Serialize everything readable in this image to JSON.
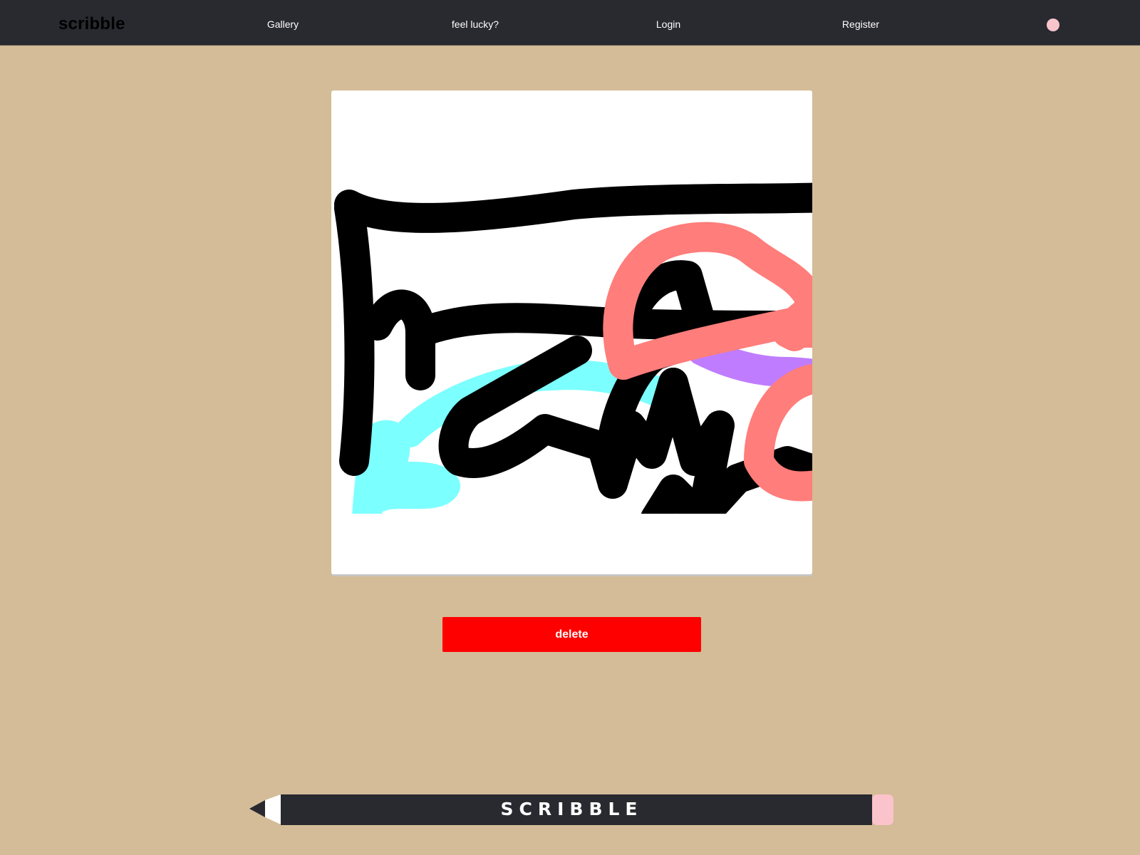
{
  "header": {
    "brand": "scribble",
    "nav": [
      {
        "label": "Gallery"
      },
      {
        "label": "feel lucky?"
      },
      {
        "label": "Login"
      },
      {
        "label": "Register"
      }
    ],
    "status_dot_color": "#f9c4cc"
  },
  "drawing": {
    "stroke_colors": [
      "#000000",
      "#ff7d7a",
      "#7cffff",
      "#c07cff"
    ]
  },
  "actions": {
    "delete_label": "delete"
  },
  "footer": {
    "pencil_label": "SCRIBBLE"
  },
  "colors": {
    "page_background": "#d3bc97",
    "header_background": "#292930",
    "delete_button": "#ff0000",
    "pencil_eraser": "#fbc3cc"
  }
}
